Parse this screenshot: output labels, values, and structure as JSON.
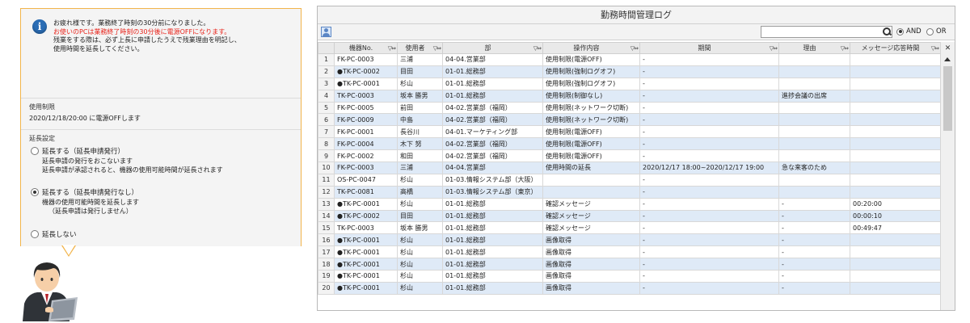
{
  "notification": {
    "message_lines": [
      {
        "text": "お疲れ様です。業務終了時刻の30分前になりました。",
        "color": "#222222"
      },
      {
        "text": "お使いのPCは業務終了時刻の30分後に電源OFFになります。",
        "color": "#e8231a"
      },
      {
        "text": "残業をする際は、必ず上長に申請したうえで残業理由を明記し、",
        "color": "#222222"
      },
      {
        "text": "使用時間を延長してください。",
        "color": "#222222"
      }
    ],
    "limit_title": "使用制限",
    "limit_text": "2020/12/18/20:00 に電源OFFします",
    "extend_title": "延長設定",
    "options": [
      {
        "label": "延長する（延長申請発行）",
        "selected": false,
        "desc": [
          "延長申請の発行をおこないます",
          "延長申請が承認されると、機器の使用可能時間が延長されます"
        ]
      },
      {
        "label": "延長する（延長申請発行なし）",
        "selected": true,
        "desc": [
          "機器の使用可能時間を延長します",
          "（延長申請は発行しません）"
        ]
      },
      {
        "label": "延長しない",
        "selected": false,
        "desc": []
      }
    ]
  },
  "log": {
    "title": "勤務時間管理ログ",
    "search_placeholder": "",
    "mode_and": "AND",
    "mode_or": "OR",
    "mode_selected": "AND",
    "filter_glyph": "▽⇔",
    "columns": [
      "機器No.",
      "使用者",
      "部",
      "操作内容",
      "期間",
      "理由",
      "メッセージ応答時間"
    ],
    "rows": [
      [
        "1",
        "FK-PC-0003",
        "三浦",
        "04-04.営業部",
        "使用制限(電源OFF)",
        "-",
        "",
        ""
      ],
      [
        "2",
        "●TK-PC-0002",
        "目田",
        "01-01.総務部",
        "使用制限(強制ログオフ)",
        "-",
        "",
        ""
      ],
      [
        "3",
        "●TK-PC-0001",
        "杉山",
        "01-01.総務部",
        "使用制限(強制ログオフ)",
        "-",
        "",
        ""
      ],
      [
        "4",
        "TK-PC-0003",
        "坂本 勝男",
        "01-01.総務部",
        "使用制限(制御なし)",
        "-",
        "進捗会議の出席",
        ""
      ],
      [
        "5",
        "FK-PC-0005",
        "前田",
        "04-02.営業部（福岡）",
        "使用制限(ネットワーク切断)",
        "-",
        "",
        ""
      ],
      [
        "6",
        "FK-PC-0009",
        "中島",
        "04-02.営業部（福岡）",
        "使用制限(ネットワーク切断)",
        "-",
        "",
        ""
      ],
      [
        "7",
        "FK-PC-0001",
        "長谷川",
        "04-01.マーケティング部",
        "使用制限(電源OFF)",
        "-",
        "",
        ""
      ],
      [
        "8",
        "FK-PC-0004",
        "木下 努",
        "04-02.営業部（福岡）",
        "使用制限(電源OFF)",
        "-",
        "",
        ""
      ],
      [
        "9",
        "FK-PC-0002",
        "和田",
        "04-02.営業部（福岡）",
        "使用制限(電源OFF)",
        "-",
        "",
        ""
      ],
      [
        "10",
        "FK-PC-0003",
        "三浦",
        "04-04.営業部",
        "使用時間の延長",
        "2020/12/17  18:00~2020/12/17  19:00",
        "急な来客のため",
        ""
      ],
      [
        "11",
        "OS-PC-0047",
        "杉山",
        "01-03.情報システム部（大阪）",
        "",
        "-",
        "",
        ""
      ],
      [
        "12",
        "TK-PC-0081",
        "高橋",
        "01-03.情報システム部（東京）",
        "",
        "-",
        "",
        ""
      ],
      [
        "13",
        "●TK-PC-0001",
        "杉山",
        "01-01.総務部",
        "確認メッセージ",
        "-",
        "-",
        "00:20:00"
      ],
      [
        "14",
        "●TK-PC-0002",
        "目田",
        "01-01.総務部",
        "確認メッセージ",
        "-",
        "-",
        "00:00:10"
      ],
      [
        "15",
        "TK-PC-0003",
        "坂本 勝男",
        "01-01.総務部",
        "確認メッセージ",
        "-",
        "-",
        "00:49:47"
      ],
      [
        "16",
        "●TK-PC-0001",
        "杉山",
        "01-01.総務部",
        "画像取得",
        "-",
        "-",
        ""
      ],
      [
        "17",
        "●TK-PC-0001",
        "杉山",
        "01-01.総務部",
        "画像取得",
        "-",
        "-",
        ""
      ],
      [
        "18",
        "●TK-PC-0001",
        "杉山",
        "01-01.総務部",
        "画像取得",
        "-",
        "-",
        ""
      ],
      [
        "19",
        "●TK-PC-0001",
        "杉山",
        "01-01.総務部",
        "画像取得",
        "-",
        "-",
        ""
      ],
      [
        "20",
        "●TK-PC-0001",
        "杉山",
        "01-01.総務部",
        "画像取得",
        "-",
        "-",
        ""
      ]
    ]
  },
  "colors": {
    "accent_orange": "#f2b44a",
    "alert_red": "#e8231a",
    "row_alt": "#dfeaf7",
    "info_blue": "#2a6db5"
  }
}
